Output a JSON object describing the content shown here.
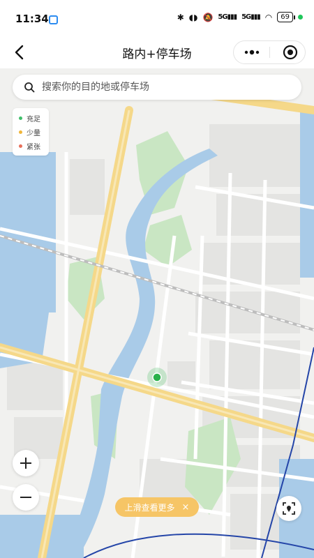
{
  "status_bar": {
    "time": "11:34",
    "network_label": "5G",
    "network_label_2": "5G",
    "battery": "69"
  },
  "nav": {
    "title": "路内+停车场"
  },
  "search": {
    "placeholder": "搜索你的目的地或停车场"
  },
  "legend": {
    "items": [
      {
        "label": "充足",
        "color": "#3fbf6a"
      },
      {
        "label": "少量",
        "color": "#f0b63a"
      },
      {
        "label": "紧张",
        "color": "#e8705a"
      }
    ]
  },
  "map_controls": {
    "zoom_in_label": "+",
    "zoom_out_label": "−"
  },
  "bottom_hint": {
    "label": "上滑查看更多",
    "close_glyph": "×"
  },
  "colors": {
    "accent_green": "#29b14a",
    "hint_bg": "#f6c566",
    "water": "#a9cbe8",
    "park": "#c9e6c3",
    "major_road": "#f5d889"
  }
}
